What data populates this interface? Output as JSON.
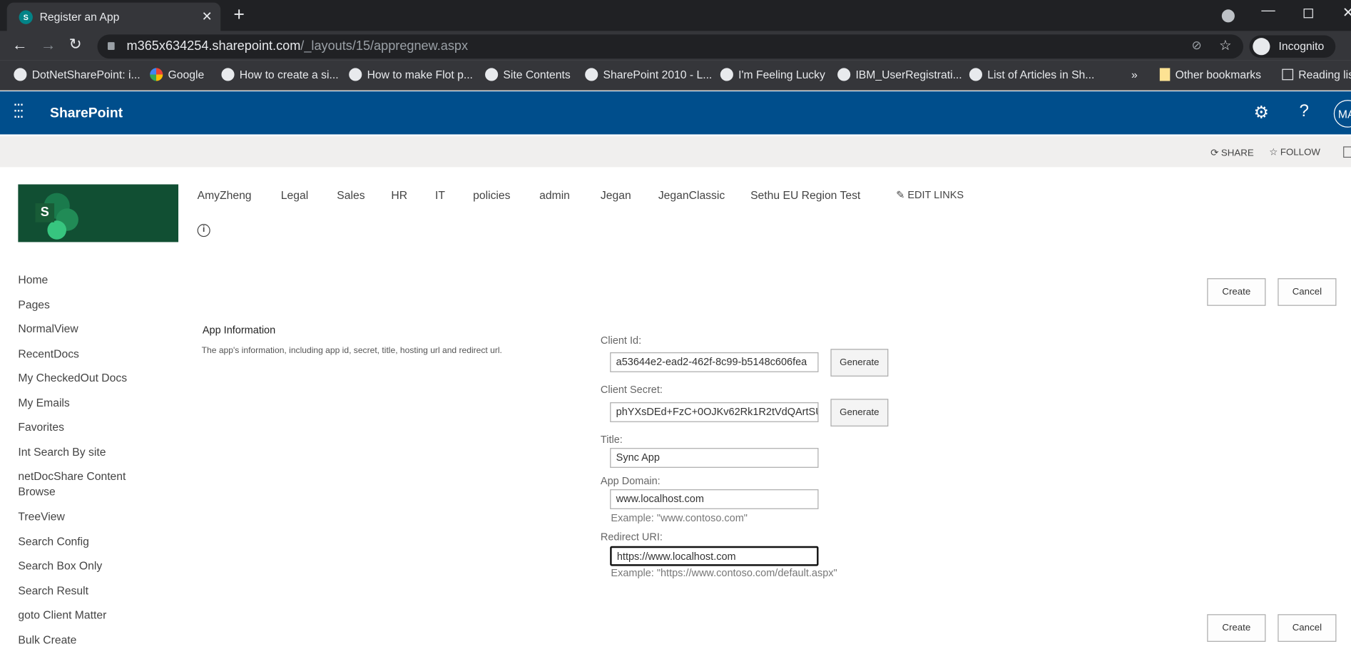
{
  "browser": {
    "tab_title": "Register an App",
    "url_host": "m365x634254.sharepoint.com",
    "url_path": "/_layouts/15/appregnew.aspx",
    "profile": "Incognito",
    "bookmarks": [
      "DotNetSharePoint: i...",
      "Google",
      "How to create a si...",
      "How to make Flot p...",
      "Site Contents",
      "SharePoint 2010 - L...",
      "I'm Feeling Lucky",
      "IBM_UserRegistrati...",
      "List of Articles in Sh..."
    ],
    "other_bookmarks": "Other bookmarks",
    "reading_list": "Reading list",
    "overflow": "»"
  },
  "suite": {
    "brand": "SharePoint",
    "avatar": "MA"
  },
  "ribbon": {
    "share": "SHARE",
    "follow": "FOLLOW"
  },
  "topnav": {
    "items": [
      "AmyZheng",
      "Legal",
      "Sales",
      "HR",
      "IT",
      "policies",
      "admin",
      "Jegan",
      "JeganClassic",
      "Sethu EU Region Test"
    ],
    "edit_links": "EDIT LINKS"
  },
  "leftnav": {
    "items": [
      "Home",
      "Pages",
      "NormalView",
      "RecentDocs",
      "My CheckedOut Docs",
      "My Emails",
      "Favorites",
      "Int Search By site",
      "netDocShare Content Browse",
      "TreeView",
      "Search Config",
      "Search Box Only",
      "Search Result",
      "goto Client Matter",
      "Bulk Create"
    ]
  },
  "form": {
    "section_title": "App Information",
    "section_desc": "The app's information, including app id, secret, title, hosting url and redirect url.",
    "client_id_label": "Client Id:",
    "client_id": "a53644e2-ead2-462f-8c99-b5148c606fea",
    "client_secret_label": "Client Secret:",
    "client_secret": "phYXsDEd+FzC+0OJKv62Rk1R2tVdQArtSU(",
    "title_label": "Title:",
    "title": "Sync App",
    "domain_label": "App Domain:",
    "domain": "www.localhost.com",
    "domain_example": "Example: \"www.contoso.com\"",
    "redirect_label": "Redirect URI:",
    "redirect": "https://www.localhost.com",
    "redirect_example": "Example: \"https://www.contoso.com/default.aspx\"",
    "generate": "Generate",
    "create": "Create",
    "cancel": "Cancel"
  },
  "colors": {
    "suite_bar": "#004e8c",
    "logo_bg": "#114f33",
    "chrome_dark": "#202124"
  }
}
